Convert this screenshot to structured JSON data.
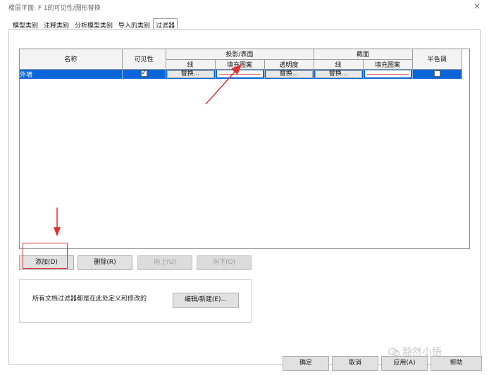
{
  "window": {
    "title": "楼层平面: F 1的可见性/图形替换",
    "close_glyph": "✕"
  },
  "tabs": [
    {
      "label": "模型类别",
      "active": false
    },
    {
      "label": "注释类别",
      "active": false
    },
    {
      "label": "分析模型类别",
      "active": false
    },
    {
      "label": "导入的类别",
      "active": false
    },
    {
      "label": "过滤器",
      "active": true
    }
  ],
  "grid": {
    "headers": {
      "name": "名称",
      "visibility": "可见性",
      "projection_group": "投影/表面",
      "section_group": "截面",
      "halftone": "半色调",
      "proj_line": "线",
      "proj_fill": "填充图案",
      "proj_transparency": "透明度",
      "section_line": "线",
      "section_fill": "填充图案"
    },
    "rows": [
      {
        "name": "外墙",
        "visible": true,
        "proj_line": "替换...",
        "proj_transparency": "替换...",
        "section_line": "替换...",
        "halftone": false
      }
    ]
  },
  "buttons": {
    "add": "添加(D)",
    "delete": "删除(R)",
    "up": "向上(U)",
    "down": "向下(O)",
    "edit_new": "编辑/新建(E)...",
    "ok": "确定",
    "cancel": "取消",
    "apply": "应用(A)",
    "help": "帮助"
  },
  "info": {
    "text": "所有文档过滤器都是在此处定义和修改的"
  },
  "watermark": {
    "text": "豁然小悟"
  },
  "colors": {
    "selection": "#0a66d8",
    "annotation_red": "#e03131",
    "pattern_line": "#d84a4a"
  }
}
